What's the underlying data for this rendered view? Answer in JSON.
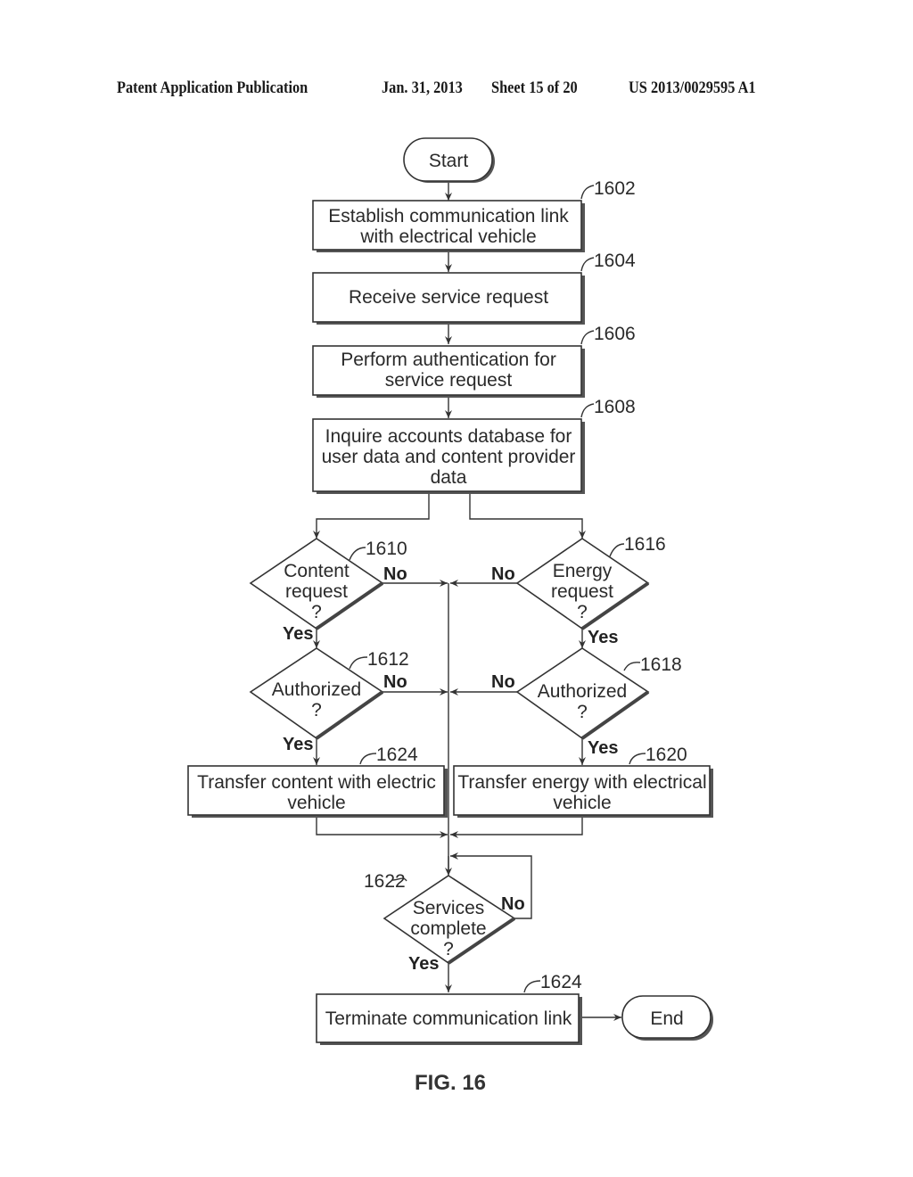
{
  "header": {
    "publication": "Patent Application Publication",
    "date": "Jan. 31, 2013",
    "sheet": "Sheet 15 of 20",
    "patent_number": "US 2013/0029595 A1"
  },
  "figure_label": "FIG. 16",
  "nodes": {
    "start": {
      "label": "Start"
    },
    "n1602": {
      "ref": "1602",
      "lines": [
        "Establish communication link",
        "with electrical vehicle"
      ]
    },
    "n1604": {
      "ref": "1604",
      "lines": [
        "Receive service request"
      ]
    },
    "n1606": {
      "ref": "1606",
      "lines": [
        "Perform authentication for",
        "service request"
      ]
    },
    "n1608": {
      "ref": "1608",
      "lines": [
        "Inquire accounts database for",
        "user data and content provider",
        "data"
      ]
    },
    "n1610": {
      "ref": "1610",
      "lines": [
        "Content",
        "request",
        "?"
      ]
    },
    "n1612": {
      "ref": "1612",
      "lines": [
        "Authorized",
        "?"
      ]
    },
    "n1616": {
      "ref": "1616",
      "lines": [
        "Energy",
        "request",
        "?"
      ]
    },
    "n1618": {
      "ref": "1618",
      "lines": [
        "Authorized",
        "?"
      ]
    },
    "n1624a": {
      "ref": "1624",
      "lines": [
        "Transfer content with electric",
        "vehicle"
      ]
    },
    "n1620": {
      "ref": "1620",
      "lines": [
        "Transfer energy with electrical",
        "vehicle"
      ]
    },
    "n1622": {
      "ref": "1622",
      "lines": [
        "Services",
        "complete",
        "?"
      ]
    },
    "n1624b": {
      "ref": "1624",
      "lines": [
        "Terminate communication link"
      ]
    },
    "end": {
      "label": "End"
    }
  },
  "branch_labels": {
    "yes": "Yes",
    "no": "No"
  }
}
